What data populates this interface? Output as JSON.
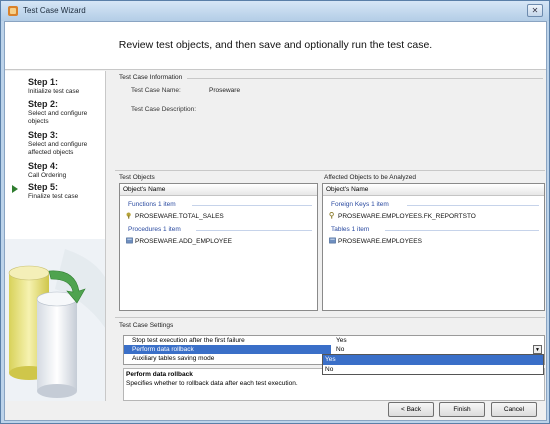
{
  "window": {
    "title": "Test Case Wizard"
  },
  "header": {
    "title": "Review test objects, and then save and optionally run the test case."
  },
  "steps": [
    {
      "number": "Step 1:",
      "desc": "Initialize test case"
    },
    {
      "number": "Step 2:",
      "desc": "Select and configure objects"
    },
    {
      "number": "Step 3:",
      "desc": "Select and configure affected objects"
    },
    {
      "number": "Step 4:",
      "desc": "Call Ordering"
    },
    {
      "number": "Step 5:",
      "desc": "Finalize test case",
      "current": true
    }
  ],
  "info": {
    "group_title": "Test Case Information",
    "name_label": "Test Case Name:",
    "name_value": "Proseware",
    "description_label": "Test Case Description:"
  },
  "test_objects": {
    "title": "Test Objects",
    "column": "Object's Name",
    "groups": [
      {
        "header": "Functions 1 item",
        "items": [
          "PROSEWARE.TOTAL_SALES"
        ]
      },
      {
        "header": "Procedures 1 item",
        "items": [
          "PROSEWARE.ADD_EMPLOYEE"
        ]
      }
    ]
  },
  "affected_objects": {
    "title": "Affected Objects to be Analyzed",
    "column": "Object's Name",
    "groups": [
      {
        "header": "Foreign Keys 1 item",
        "items": [
          "PROSEWARE.EMPLOYEES.FK_REPORTSTO"
        ]
      },
      {
        "header": "Tables 1 item",
        "items": [
          "PROSEWARE.EMPLOYEES"
        ]
      }
    ]
  },
  "settings": {
    "title": "Test Case Settings",
    "rows": [
      {
        "name": "Stop test execution after the first failure",
        "value": "Yes"
      },
      {
        "name": "Perform data rollback",
        "value": "No"
      },
      {
        "name": "Auxiliary tables saving mode",
        "value": ""
      }
    ],
    "dropdown_options": [
      "Yes",
      "No"
    ],
    "dropdown_selected": "Yes"
  },
  "description": {
    "title": "Perform data rollback",
    "text": "Specifies whether to rollback data after each test execution."
  },
  "buttons": {
    "back": "< Back",
    "finish": "Finish",
    "cancel": "Cancel"
  },
  "colors": {
    "selection": "#3a6fc8",
    "group_header": "#2a4aa0",
    "step_arrow": "#2f7d2f"
  }
}
